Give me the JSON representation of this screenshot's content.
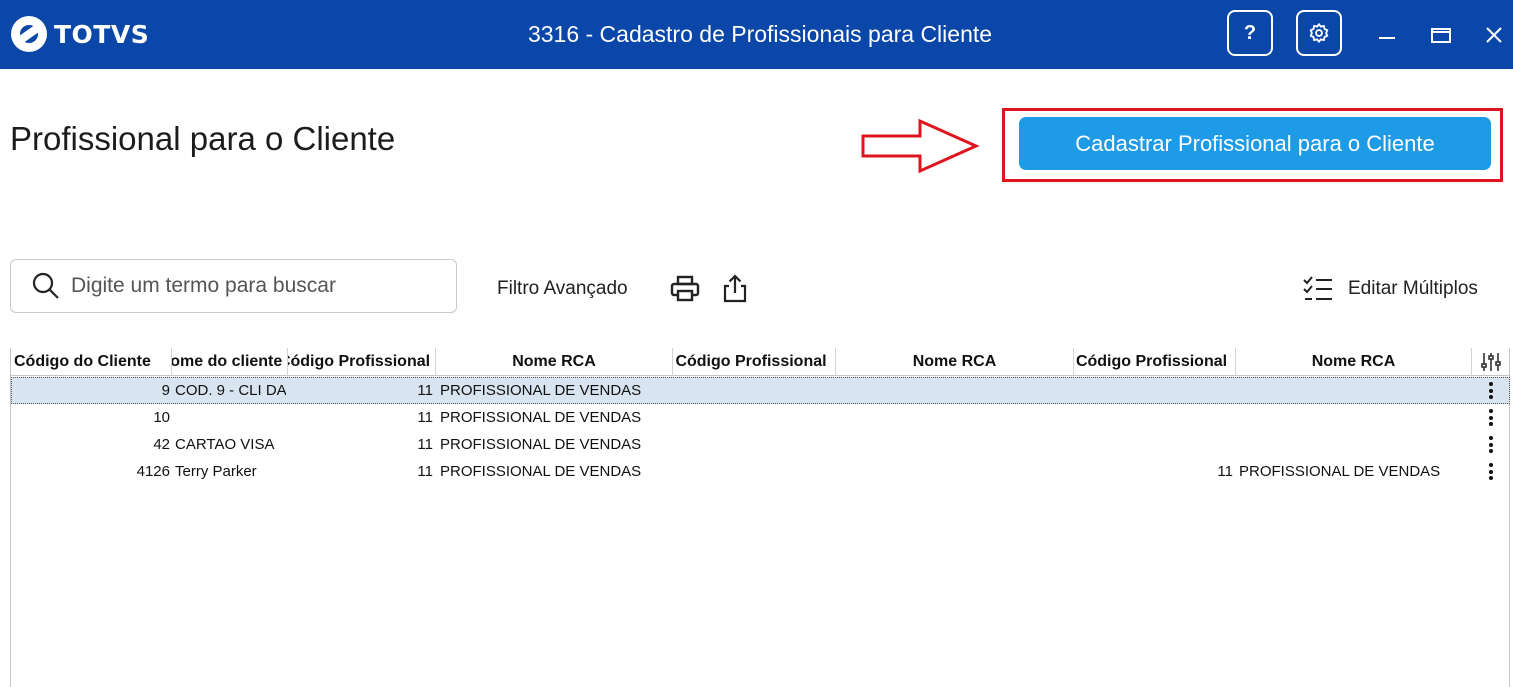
{
  "titlebar": {
    "logo_text": "TOTVS",
    "title": "3316 - Cadastro de Profissionais para Cliente",
    "help_label": "?",
    "settings_icon": "gear-icon",
    "minimize_icon": "minimize-icon",
    "maximize_icon": "maximize-icon",
    "close_icon": "close-icon",
    "background_color": "#0a47a8"
  },
  "page": {
    "title": "Profissional para o Cliente",
    "primary_button_label": "Cadastrar Profissional para o Cliente",
    "primary_button_color": "#1e9be6",
    "annotation_color": "#e0141e"
  },
  "toolbar": {
    "search_placeholder": "Digite um termo para buscar",
    "search_value": "",
    "advanced_filter_label": "Filtro Avançado",
    "print_icon": "print-icon",
    "export_icon": "share-icon",
    "edit_multiple_label": "Editar Múltiplos",
    "edit_multiple_icon": "checklist-icon"
  },
  "grid": {
    "columns": [
      "Código do Cliente",
      "Nome do cliente",
      "Código Profissional",
      "Nome RCA",
      "Código Profissional",
      "Nome RCA",
      "Código Profissional",
      "Nome RCA"
    ],
    "column_settings_icon": "sliders-icon",
    "rows": [
      [
        "9",
        "COD. 9 - CLI DA",
        "11",
        "PROFISSIONAL DE VENDAS",
        "",
        "",
        "",
        ""
      ],
      [
        "10",
        "",
        "11",
        "PROFISSIONAL DE VENDAS",
        "",
        "",
        "",
        ""
      ],
      [
        "42",
        "CARTAO VISA",
        "11",
        "PROFISSIONAL DE VENDAS",
        "",
        "",
        "",
        ""
      ],
      [
        "4126",
        "Terry Parker",
        "11",
        "PROFISSIONAL DE VENDAS",
        "",
        "",
        "11",
        "PROFISSIONAL DE VENDAS"
      ]
    ],
    "selected_row": 0
  }
}
